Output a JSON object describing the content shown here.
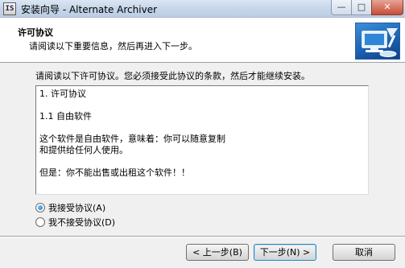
{
  "window": {
    "icon_text": "IS",
    "title": "安装向导 - Alternate Archiver",
    "minimize": "—",
    "maximize": "□",
    "close": "✕"
  },
  "header": {
    "title": "许可协议",
    "subtitle": "请阅读以下重要信息，然后再进入下一步。",
    "image_icon": "computer-setup-icon"
  },
  "body": {
    "intro": "请阅读以下许可协议。您必须接受此协议的条款，然后才能继续安装。",
    "license_lines": [
      "1. 许可协议",
      "",
      "1.1 自由软件",
      "",
      "这个软件是自由软件，意味着：你可以随意复制",
      "和提供给任何人使用。",
      "",
      "但是：你不能出售或出租这个软件！！"
    ],
    "radio_accept": "我接受协议(A)",
    "radio_decline": "我不接受协议(D)",
    "accept_selected": true
  },
  "footer": {
    "back": "< 上一步(B)",
    "next": "下一步(N) >",
    "cancel": "取消"
  }
}
